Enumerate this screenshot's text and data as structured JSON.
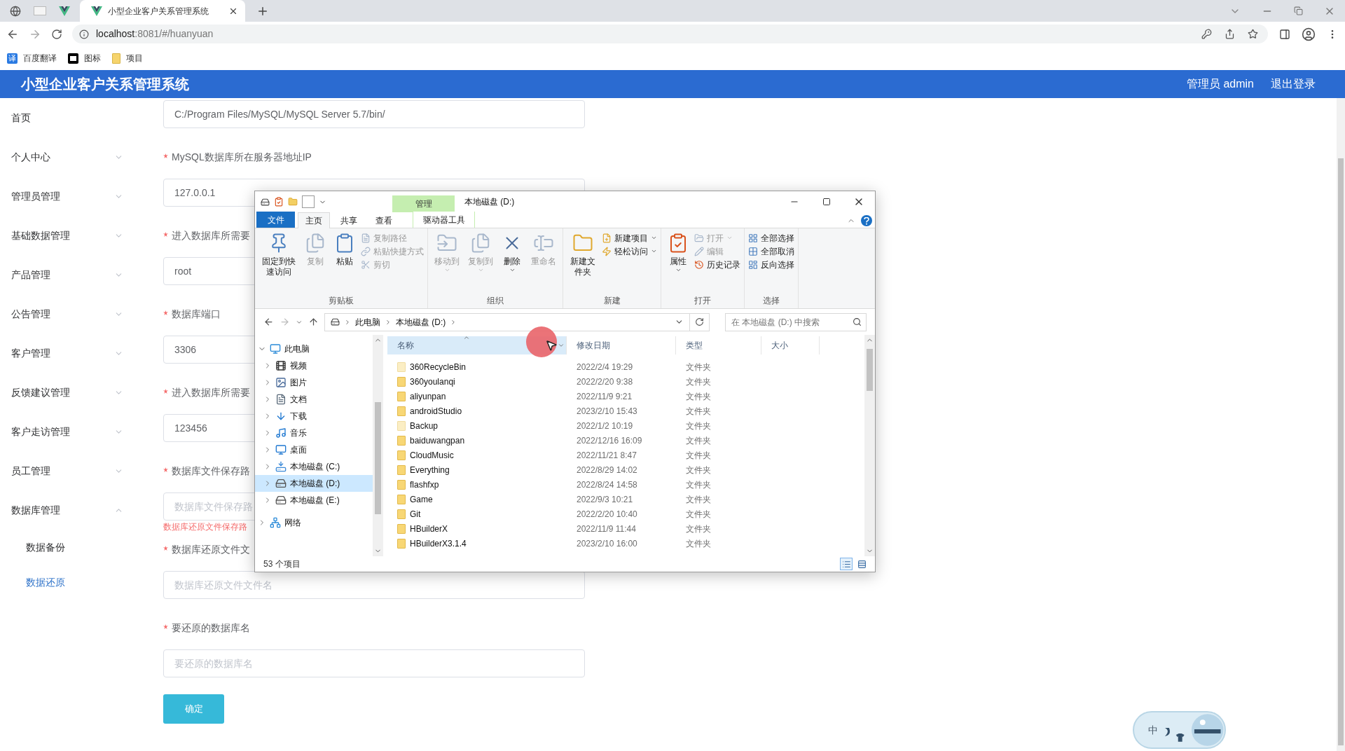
{
  "browser": {
    "active_tab": {
      "title": "小型企业客户关系管理系统"
    },
    "url": {
      "host": "localhost",
      "rest": ":8081/#/huanyuan"
    },
    "bookmarks": [
      {
        "label": "百度翻译",
        "icon_text": "译",
        "kind": "translate"
      },
      {
        "label": "图标",
        "kind": "flag"
      },
      {
        "label": "项目",
        "kind": "folder"
      }
    ]
  },
  "header": {
    "title": "小型企业客户关系管理系统",
    "user": "管理员 admin",
    "logout": "退出登录"
  },
  "sidebar": [
    {
      "label": "首页",
      "kind": "link"
    },
    {
      "label": "个人中心",
      "kind": "group",
      "expanded": false
    },
    {
      "label": "管理员管理",
      "kind": "group",
      "expanded": false
    },
    {
      "label": "基础数据管理",
      "kind": "group",
      "expanded": false
    },
    {
      "label": "产品管理",
      "kind": "group",
      "expanded": false
    },
    {
      "label": "公告管理",
      "kind": "group",
      "expanded": false
    },
    {
      "label": "客户管理",
      "kind": "group",
      "expanded": false
    },
    {
      "label": "反馈建议管理",
      "kind": "group",
      "expanded": false
    },
    {
      "label": "客户走访管理",
      "kind": "group",
      "expanded": false
    },
    {
      "label": "员工管理",
      "kind": "group",
      "expanded": false
    },
    {
      "label": "数据库管理",
      "kind": "group",
      "expanded": true,
      "children": [
        {
          "label": "数据备份",
          "selected": false
        },
        {
          "label": "数据还原",
          "selected": true
        }
      ]
    }
  ],
  "form": {
    "fields": [
      {
        "value": "C:/Program Files/MySQL/MySQL Server 5.7/bin/"
      },
      {
        "label": "MySQL数据库所在服务器地址IP",
        "required": true,
        "value": "127.0.0.1"
      },
      {
        "label": "进入数据库所需要",
        "required": true,
        "value": "root"
      },
      {
        "label": "数据库端口",
        "required": true,
        "value": "3306"
      },
      {
        "label": "进入数据库所需要",
        "required": true,
        "value": "123456"
      },
      {
        "label": "数据库文件保存路",
        "required": true,
        "placeholder": "数据库文件保存路",
        "error": "数据库还原文件保存路"
      },
      {
        "label": "数据库还原文件文",
        "required": true,
        "placeholder": "数据库还原文件文件名"
      },
      {
        "label": "要还原的数据库名",
        "required": true,
        "placeholder": "要还原的数据库名"
      }
    ],
    "submit": "确定"
  },
  "explorer": {
    "title": "本地磁盘 (D:)",
    "context_label": "管理",
    "tabs": [
      {
        "label": "文件",
        "kind": "file",
        "selected": false
      },
      {
        "label": "主页",
        "kind": "tab",
        "selected": true
      },
      {
        "label": "共享",
        "kind": "tab",
        "selected": false
      },
      {
        "label": "查看",
        "kind": "tab",
        "selected": false
      },
      {
        "label": "驱动器工具",
        "kind": "context",
        "selected": false
      }
    ],
    "groups": [
      {
        "label": "剪贴板",
        "items": [
          {
            "label": "固定到快速访问",
            "kind": "large",
            "disabled": false
          },
          {
            "label": "复制",
            "kind": "large",
            "disabled": true
          },
          {
            "label": "粘贴",
            "kind": "large",
            "disabled": false
          },
          {
            "label": "复制路径",
            "kind": "small",
            "disabled": true
          },
          {
            "label": "粘贴快捷方式",
            "kind": "small",
            "disabled": true
          },
          {
            "label": "剪切",
            "kind": "small",
            "disabled": true
          }
        ]
      },
      {
        "label": "组织",
        "items": [
          {
            "label": "移动到",
            "kind": "large",
            "disabled": true,
            "dropdown": true
          },
          {
            "label": "复制到",
            "kind": "large",
            "disabled": true,
            "dropdown": true
          },
          {
            "label": "删除",
            "kind": "large",
            "disabled": false,
            "dropdown": true
          },
          {
            "label": "重命名",
            "kind": "large",
            "disabled": true
          }
        ]
      },
      {
        "label": "新建",
        "items": [
          {
            "label": "新建文件夹",
            "kind": "large",
            "disabled": false
          },
          {
            "label": "新建项目",
            "kind": "small",
            "disabled": false,
            "dropdown": true
          },
          {
            "label": "轻松访问",
            "kind": "small",
            "disabled": false,
            "dropdown": true
          }
        ]
      },
      {
        "label": "打开",
        "items": [
          {
            "label": "属性",
            "kind": "large",
            "disabled": false,
            "dropdown": true
          },
          {
            "label": "打开",
            "kind": "small",
            "disabled": true,
            "dropdown": true
          },
          {
            "label": "编辑",
            "kind": "small",
            "disabled": true
          },
          {
            "label": "历史记录",
            "kind": "small",
            "disabled": false
          }
        ]
      },
      {
        "label": "选择",
        "items": [
          {
            "label": "全部选择",
            "kind": "small",
            "disabled": false
          },
          {
            "label": "全部取消",
            "kind": "small",
            "disabled": false
          },
          {
            "label": "反向选择",
            "kind": "small",
            "disabled": false
          }
        ]
      }
    ],
    "address": [
      "此电脑",
      "本地磁盘 (D:)"
    ],
    "search_placeholder": "在 本地磁盘 (D:) 中搜索",
    "tree": [
      {
        "label": "此电脑",
        "expanded": true,
        "selected": false,
        "children": [
          {
            "label": "视频",
            "expanded": false,
            "selected": false
          },
          {
            "label": "图片",
            "expanded": false,
            "selected": false
          },
          {
            "label": "文档",
            "expanded": false,
            "selected": false
          },
          {
            "label": "下载",
            "expanded": false,
            "selected": false
          },
          {
            "label": "音乐",
            "expanded": false,
            "selected": false
          },
          {
            "label": "桌面",
            "expanded": false,
            "selected": false
          },
          {
            "label": "本地磁盘 (C:)",
            "expanded": false,
            "selected": false
          },
          {
            "label": "本地磁盘 (D:)",
            "expanded": false,
            "selected": true
          },
          {
            "label": "本地磁盘 (E:)",
            "expanded": false,
            "selected": false
          }
        ]
      },
      {
        "label": "网络",
        "expanded": false,
        "selected": false
      }
    ],
    "columns": [
      {
        "label": "名称",
        "sorted": true
      },
      {
        "label": "修改日期",
        "sorted": false
      },
      {
        "label": "类型",
        "sorted": false
      },
      {
        "label": "大小",
        "sorted": false
      }
    ],
    "rows": [
      {
        "name": "360RecycleBin",
        "date": "2022/2/4 19:29",
        "type": "文件夹",
        "hidden": true
      },
      {
        "name": "360youlanqi",
        "date": "2022/2/20 9:38",
        "type": "文件夹",
        "hidden": false
      },
      {
        "name": "aliyunpan",
        "date": "2022/11/9 9:21",
        "type": "文件夹",
        "hidden": false
      },
      {
        "name": "androidStudio",
        "date": "2023/2/10 15:43",
        "type": "文件夹",
        "hidden": false
      },
      {
        "name": "Backup",
        "date": "2022/1/2 10:19",
        "type": "文件夹",
        "hidden": true
      },
      {
        "name": "baiduwangpan",
        "date": "2022/12/16 16:09",
        "type": "文件夹",
        "hidden": false
      },
      {
        "name": "CloudMusic",
        "date": "2022/11/21 8:47",
        "type": "文件夹",
        "hidden": false
      },
      {
        "name": "Everything",
        "date": "2022/8/29 14:02",
        "type": "文件夹",
        "hidden": false
      },
      {
        "name": "flashfxp",
        "date": "2022/8/24 14:58",
        "type": "文件夹",
        "hidden": false
      },
      {
        "name": "Game",
        "date": "2022/9/3 10:21",
        "type": "文件夹",
        "hidden": false
      },
      {
        "name": "Git",
        "date": "2022/2/20 10:40",
        "type": "文件夹",
        "hidden": false
      },
      {
        "name": "HBuilderX",
        "date": "2022/11/9 11:44",
        "type": "文件夹",
        "hidden": false
      },
      {
        "name": "HBuilderX3.1.4",
        "date": "2023/2/10 16:00",
        "type": "文件夹",
        "hidden": false
      }
    ],
    "status": "53 个项目",
    "view_modes": [
      {
        "kind": "details",
        "selected": true
      },
      {
        "kind": "tiles",
        "selected": false
      }
    ]
  },
  "ime": {
    "label": "中"
  }
}
